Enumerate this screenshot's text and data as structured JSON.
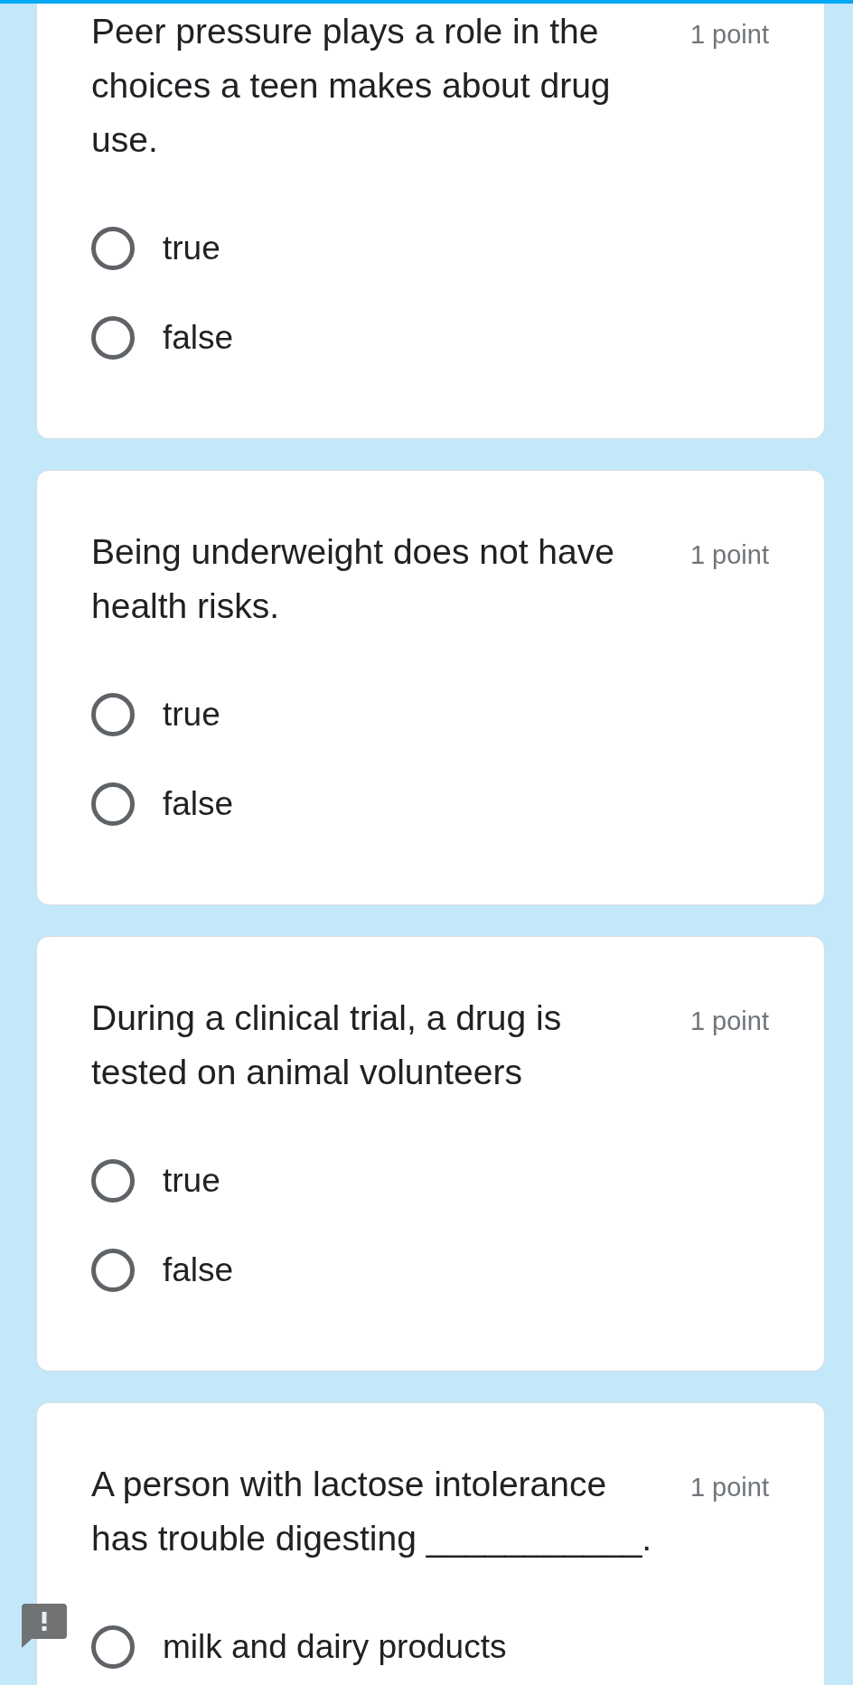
{
  "questions": [
    {
      "text": "Peer pressure plays a role in the choices a teen makes about drug use.",
      "points": "1 point",
      "flagged": false,
      "options": [
        {
          "label": "true",
          "selected": false
        },
        {
          "label": "false",
          "selected": false
        }
      ]
    },
    {
      "text": "Being underweight does not have health risks.",
      "points": "1 point",
      "flagged": false,
      "options": [
        {
          "label": "true",
          "selected": false
        },
        {
          "label": "false",
          "selected": false
        }
      ]
    },
    {
      "text": "During a clinical trial, a drug is tested on animal volunteers",
      "points": "1 point",
      "flagged": false,
      "options": [
        {
          "label": "true",
          "selected": false
        },
        {
          "label": "false",
          "selected": false
        }
      ]
    },
    {
      "text": "A person with lactose intolerance has trouble digesting ___________.",
      "points": "1 point",
      "flagged": true,
      "options": [
        {
          "label": "milk and dairy products",
          "selected": false
        }
      ]
    }
  ]
}
